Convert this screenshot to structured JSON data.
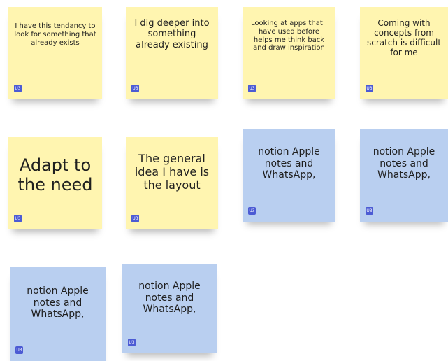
{
  "board": {
    "badge_label": "U3",
    "notes": [
      {
        "text": "I have this tendancy to look for something that already exists",
        "color": "#fff5b0"
      },
      {
        "text": "I dig deeper into something already existing",
        "color": "#fff5b0"
      },
      {
        "text": "Looking at apps that I have used before helps me think back and draw inspiration",
        "color": "#fff5b0"
      },
      {
        "text": "Coming with concepts from scratch is difficult for me",
        "color": "#fff5b0"
      },
      {
        "text": "Adapt to the need",
        "color": "#fff5b0"
      },
      {
        "text": "The general idea I have is the layout",
        "color": "#fff5b0"
      },
      {
        "text": "notion Apple notes and WhatsApp,",
        "color": "#b9cff0"
      },
      {
        "text": "notion Apple notes and WhatsApp,",
        "color": "#b9cff0"
      },
      {
        "text": "notion Apple notes and WhatsApp,",
        "color": "#b9cff0"
      },
      {
        "text": "notion Apple notes and WhatsApp,",
        "color": "#b9cff0"
      }
    ],
    "badge_color": "#4c5bd4"
  }
}
